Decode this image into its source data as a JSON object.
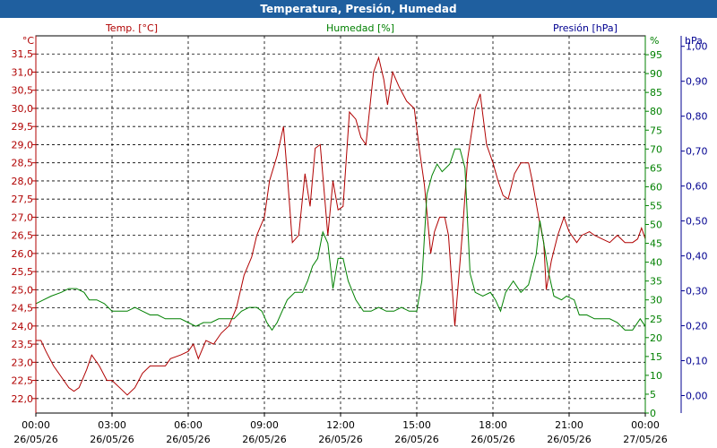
{
  "window": {
    "title": "Temperatura, Presión, Humedad"
  },
  "colors": {
    "temperature": "#b00000",
    "humidity": "#008000",
    "pressure": "#000090",
    "titlebar": "#1f5f9f",
    "grid": "#000000"
  },
  "chart_data": {
    "type": "line",
    "title": "Temperatura, Presión, Humedad",
    "grid": true,
    "x": {
      "ticks": [
        "00:00",
        "03:00",
        "06:00",
        "09:00",
        "12:00",
        "15:00",
        "18:00",
        "21:00",
        "00:00"
      ],
      "dates": [
        "26/05/26",
        "26/05/26",
        "26/05/26",
        "26/05/26",
        "26/05/26",
        "26/05/26",
        "26/05/26",
        "26/05/26",
        "27/05/26"
      ],
      "range_hours": [
        0,
        24
      ]
    },
    "axes": {
      "temperature": {
        "label": "Temp. [°C]",
        "unit": "°C",
        "range": [
          21.6,
          32.0
        ],
        "ticks": [
          "22,0",
          "22,5",
          "23,0",
          "23,5",
          "24,0",
          "24,5",
          "25,0",
          "25,5",
          "26,0",
          "26,5",
          "27,0",
          "27,5",
          "28,0",
          "28,5",
          "29,0",
          "29,5",
          "30,0",
          "30,5",
          "31,0",
          "31,5"
        ],
        "tick_values": [
          22.0,
          22.5,
          23.0,
          23.5,
          24.0,
          24.5,
          25.0,
          25.5,
          26.0,
          26.5,
          27.0,
          27.5,
          28.0,
          28.5,
          29.0,
          29.5,
          30.0,
          30.5,
          31.0,
          31.5
        ]
      },
      "humidity": {
        "label": "Humedad [%]",
        "unit": "%",
        "range": [
          0,
          100
        ],
        "ticks": [
          "0",
          "5",
          "10",
          "15",
          "20",
          "25",
          "30",
          "35",
          "40",
          "45",
          "50",
          "55",
          "60",
          "65",
          "70",
          "75",
          "80",
          "85",
          "90",
          "95"
        ],
        "tick_values": [
          0,
          5,
          10,
          15,
          20,
          25,
          30,
          35,
          40,
          45,
          50,
          55,
          60,
          65,
          70,
          75,
          80,
          85,
          90,
          95
        ]
      },
      "pressure": {
        "label": "Presión [hPa]",
        "unit": "hPa",
        "range": [
          -0.05,
          1.03
        ],
        "ticks": [
          "0,00",
          "0,10",
          "0,20",
          "0,30",
          "0,40",
          "0,50",
          "0,60",
          "0,70",
          "0,80",
          "0,90",
          "1,00"
        ],
        "tick_values": [
          0.0,
          0.1,
          0.2,
          0.3,
          0.4,
          0.5,
          0.6,
          0.7,
          0.8,
          0.9,
          1.0
        ]
      }
    },
    "series": [
      {
        "name": "Temp. [°C]",
        "axis": "temperature",
        "points": [
          [
            0,
            23.6
          ],
          [
            0.2,
            23.6
          ],
          [
            0.4,
            23.3
          ],
          [
            0.7,
            22.9
          ],
          [
            1.0,
            22.6
          ],
          [
            1.3,
            22.3
          ],
          [
            1.5,
            22.2
          ],
          [
            1.7,
            22.3
          ],
          [
            2.0,
            22.8
          ],
          [
            2.2,
            23.2
          ],
          [
            2.5,
            22.9
          ],
          [
            2.8,
            22.5
          ],
          [
            3.0,
            22.5
          ],
          [
            3.3,
            22.3
          ],
          [
            3.6,
            22.1
          ],
          [
            3.9,
            22.3
          ],
          [
            4.2,
            22.7
          ],
          [
            4.5,
            22.9
          ],
          [
            4.8,
            22.9
          ],
          [
            5.1,
            22.9
          ],
          [
            5.3,
            23.1
          ],
          [
            5.7,
            23.2
          ],
          [
            6.0,
            23.3
          ],
          [
            6.2,
            23.5
          ],
          [
            6.4,
            23.1
          ],
          [
            6.7,
            23.6
          ],
          [
            7.0,
            23.5
          ],
          [
            7.3,
            23.8
          ],
          [
            7.6,
            24.0
          ],
          [
            7.9,
            24.5
          ],
          [
            8.2,
            25.4
          ],
          [
            8.5,
            25.9
          ],
          [
            8.7,
            26.5
          ],
          [
            9.0,
            27.0
          ],
          [
            9.2,
            28.0
          ],
          [
            9.5,
            28.7
          ],
          [
            9.75,
            29.5
          ],
          [
            9.9,
            28.2
          ],
          [
            10.1,
            26.3
          ],
          [
            10.35,
            26.5
          ],
          [
            10.6,
            28.2
          ],
          [
            10.8,
            27.3
          ],
          [
            11.0,
            28.9
          ],
          [
            11.2,
            29.0
          ],
          [
            11.5,
            26.5
          ],
          [
            11.7,
            28.0
          ],
          [
            11.9,
            27.2
          ],
          [
            12.1,
            27.3
          ],
          [
            12.35,
            29.9
          ],
          [
            12.6,
            29.7
          ],
          [
            12.8,
            29.2
          ],
          [
            13.0,
            29.0
          ],
          [
            13.3,
            31.0
          ],
          [
            13.5,
            31.4
          ],
          [
            13.7,
            30.8
          ],
          [
            13.85,
            30.1
          ],
          [
            14.05,
            31.0
          ],
          [
            14.3,
            30.6
          ],
          [
            14.6,
            30.2
          ],
          [
            14.9,
            30.0
          ],
          [
            15.1,
            28.9
          ],
          [
            15.3,
            27.9
          ],
          [
            15.55,
            26.0
          ],
          [
            15.7,
            26.6
          ],
          [
            15.9,
            27.0
          ],
          [
            16.1,
            27.0
          ],
          [
            16.25,
            26.5
          ],
          [
            16.5,
            24.0
          ],
          [
            16.8,
            26.6
          ],
          [
            17.0,
            28.6
          ],
          [
            17.3,
            30.0
          ],
          [
            17.5,
            30.4
          ],
          [
            17.75,
            29.0
          ],
          [
            18.0,
            28.5
          ],
          [
            18.2,
            28.0
          ],
          [
            18.4,
            27.6
          ],
          [
            18.6,
            27.5
          ],
          [
            18.85,
            28.2
          ],
          [
            19.1,
            28.5
          ],
          [
            19.4,
            28.5
          ],
          [
            19.55,
            28.0
          ],
          [
            19.8,
            27.0
          ],
          [
            20.0,
            26.3
          ],
          [
            20.1,
            25.0
          ],
          [
            20.3,
            25.8
          ],
          [
            20.55,
            26.5
          ],
          [
            20.8,
            27.0
          ],
          [
            21.0,
            26.6
          ],
          [
            21.3,
            26.3
          ],
          [
            21.5,
            26.5
          ],
          [
            21.8,
            26.6
          ],
          [
            22.0,
            26.5
          ],
          [
            22.3,
            26.4
          ],
          [
            22.6,
            26.3
          ],
          [
            22.9,
            26.5
          ],
          [
            23.2,
            26.3
          ],
          [
            23.5,
            26.3
          ],
          [
            23.7,
            26.4
          ],
          [
            23.85,
            26.7
          ],
          [
            24.0,
            26.4
          ]
        ]
      },
      {
        "name": "Humedad [%]",
        "axis": "humidity",
        "points": [
          [
            0,
            29
          ],
          [
            0.3,
            30
          ],
          [
            0.6,
            31
          ],
          [
            1.0,
            32
          ],
          [
            1.3,
            33
          ],
          [
            1.6,
            33
          ],
          [
            1.9,
            32
          ],
          [
            2.1,
            30
          ],
          [
            2.4,
            30
          ],
          [
            2.7,
            29
          ],
          [
            3.0,
            27
          ],
          [
            3.3,
            27
          ],
          [
            3.6,
            27
          ],
          [
            3.9,
            28
          ],
          [
            4.2,
            27
          ],
          [
            4.5,
            26
          ],
          [
            4.8,
            26
          ],
          [
            5.1,
            25
          ],
          [
            5.4,
            25
          ],
          [
            5.7,
            25
          ],
          [
            6.0,
            24
          ],
          [
            6.3,
            23
          ],
          [
            6.6,
            24
          ],
          [
            6.9,
            24
          ],
          [
            7.2,
            25
          ],
          [
            7.5,
            25
          ],
          [
            7.8,
            25
          ],
          [
            8.1,
            27
          ],
          [
            8.4,
            28
          ],
          [
            8.7,
            28
          ],
          [
            8.9,
            27
          ],
          [
            9.1,
            24
          ],
          [
            9.3,
            22
          ],
          [
            9.5,
            24
          ],
          [
            9.7,
            27
          ],
          [
            9.9,
            30
          ],
          [
            10.2,
            32
          ],
          [
            10.5,
            32
          ],
          [
            10.7,
            35
          ],
          [
            10.9,
            39
          ],
          [
            11.1,
            41
          ],
          [
            11.3,
            48
          ],
          [
            11.5,
            45
          ],
          [
            11.7,
            33
          ],
          [
            11.9,
            41
          ],
          [
            12.1,
            41
          ],
          [
            12.3,
            35
          ],
          [
            12.6,
            30
          ],
          [
            12.9,
            27
          ],
          [
            13.2,
            27
          ],
          [
            13.5,
            28
          ],
          [
            13.8,
            27
          ],
          [
            14.1,
            27
          ],
          [
            14.4,
            28
          ],
          [
            14.7,
            27
          ],
          [
            15.0,
            27
          ],
          [
            15.2,
            35
          ],
          [
            15.4,
            58
          ],
          [
            15.6,
            63
          ],
          [
            15.8,
            66
          ],
          [
            16.0,
            64
          ],
          [
            16.3,
            66
          ],
          [
            16.5,
            70
          ],
          [
            16.7,
            70
          ],
          [
            16.9,
            65
          ],
          [
            17.1,
            37
          ],
          [
            17.3,
            32
          ],
          [
            17.6,
            31
          ],
          [
            17.9,
            32
          ],
          [
            18.1,
            30
          ],
          [
            18.3,
            27
          ],
          [
            18.5,
            32
          ],
          [
            18.8,
            35
          ],
          [
            19.1,
            32
          ],
          [
            19.4,
            34
          ],
          [
            19.7,
            42
          ],
          [
            19.85,
            51
          ],
          [
            20.0,
            45
          ],
          [
            20.2,
            37
          ],
          [
            20.4,
            31
          ],
          [
            20.7,
            30
          ],
          [
            20.9,
            31
          ],
          [
            21.2,
            30
          ],
          [
            21.4,
            26
          ],
          [
            21.7,
            26
          ],
          [
            22.0,
            25
          ],
          [
            22.3,
            25
          ],
          [
            22.6,
            25
          ],
          [
            22.9,
            24
          ],
          [
            23.2,
            22
          ],
          [
            23.5,
            22
          ],
          [
            23.8,
            25
          ],
          [
            24.0,
            23
          ]
        ]
      }
    ]
  }
}
